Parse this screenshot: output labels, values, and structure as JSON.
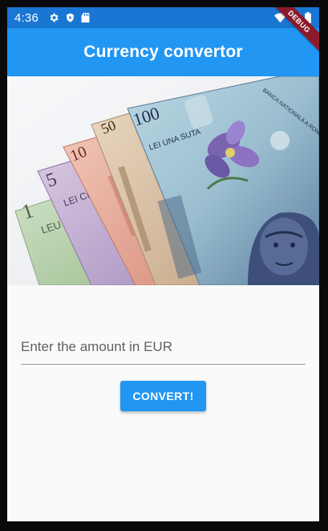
{
  "status_bar": {
    "time": "4:36",
    "left_icons": [
      "gear-icon",
      "shield-play-icon",
      "sd-card-icon"
    ],
    "right_icons": [
      "wifi-icon",
      "signal-icon",
      "battery-icon"
    ]
  },
  "debug_banner": {
    "label": "DEBUG"
  },
  "app_bar": {
    "title": "Currency convertor"
  },
  "hero": {
    "alt": "Romanian leu banknotes",
    "notes": [
      {
        "value": "1",
        "word": "LEU"
      },
      {
        "value": "5",
        "word": "LEI CINCI"
      },
      {
        "value": "10",
        "word": ""
      },
      {
        "value": "50",
        "word": ""
      },
      {
        "value": "100",
        "word": "LEI UNA SUTA"
      }
    ],
    "bank_text": "BANCA NATIONALA A ROMANIEI"
  },
  "form": {
    "amount_placeholder": "Enter the amount in EUR",
    "amount_value": "",
    "convert_label": "CONVERT!"
  },
  "colors": {
    "status_bar": "#1976d2",
    "app_bar": "#2196f3",
    "button": "#2196f3",
    "debug_banner": "#8b1a2b",
    "background": "#fafafa"
  }
}
